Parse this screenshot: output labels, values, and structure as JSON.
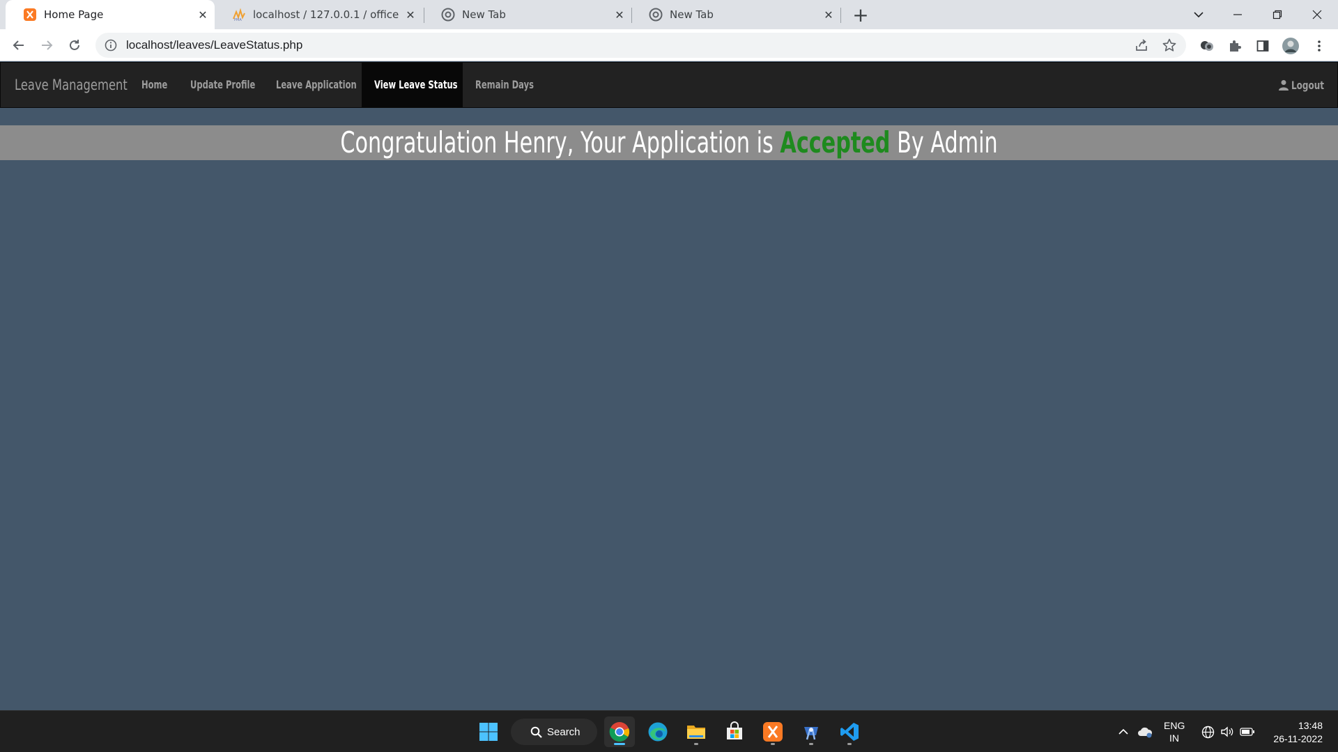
{
  "browser": {
    "tabs": [
      {
        "title": "Home Page",
        "icon": "xampp-icon",
        "active": true
      },
      {
        "title": "localhost / 127.0.0.1 / office / em",
        "icon": "phpmyadmin-icon",
        "active": false
      },
      {
        "title": "New Tab",
        "icon": "chrome-icon",
        "active": false
      },
      {
        "title": "New Tab",
        "icon": "chrome-icon",
        "active": false
      }
    ],
    "url": "localhost/leaves/LeaveStatus.php"
  },
  "site": {
    "brand": "Leave Management",
    "nav": [
      {
        "label": "Home",
        "active": false
      },
      {
        "label": "Update Profile",
        "active": false
      },
      {
        "label": "Leave Application",
        "active": false
      },
      {
        "label": "View Leave Status",
        "active": true
      },
      {
        "label": "Remain Days",
        "active": false
      }
    ],
    "logout_label": "Logout"
  },
  "status": {
    "prefix": "Congratulation Henry, Your Application is ",
    "highlight": "Accepted",
    "suffix": " By Admin",
    "highlight_color": "#1e8a1e"
  },
  "taskbar": {
    "search_label": "Search",
    "apps": [
      "start-icon",
      "chrome-icon",
      "edge-icon",
      "file-explorer-icon",
      "store-icon",
      "xampp-icon",
      "android-studio-icon",
      "vscode-icon"
    ],
    "lang_line1": "ENG",
    "lang_line2": "IN",
    "time": "13:48",
    "date": "26-11-2022"
  },
  "colors": {
    "page_bg": "#44576a",
    "navbar_bg": "#222222",
    "banner_bg": "#8c8c8c"
  }
}
